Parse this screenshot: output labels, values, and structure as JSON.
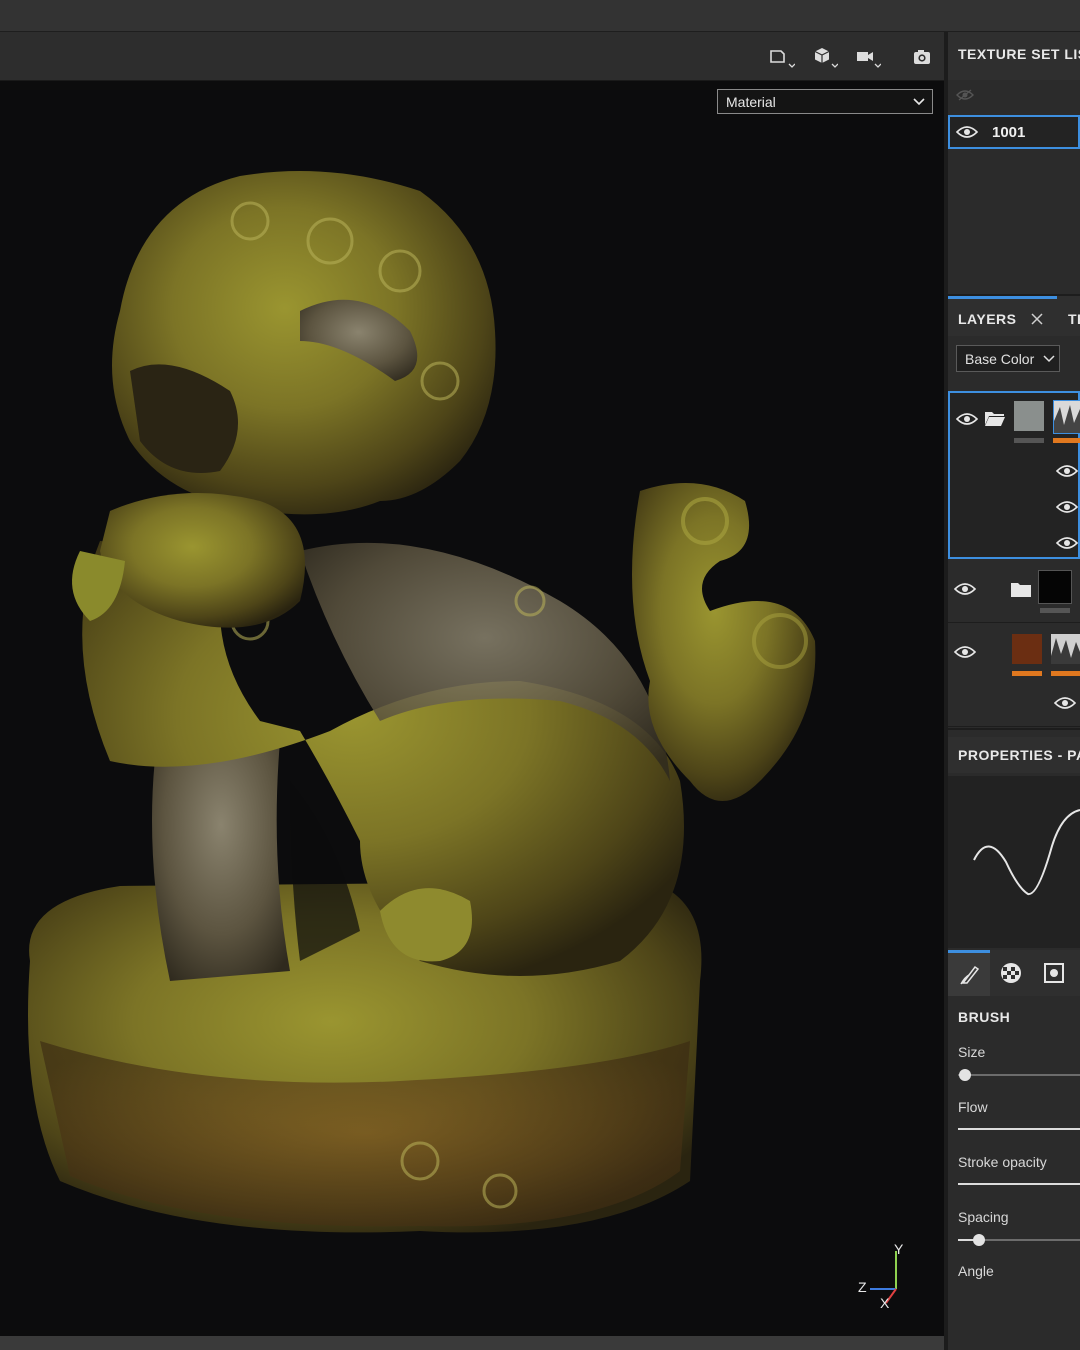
{
  "viewport": {
    "toolbar_icons": [
      "frame-select-icon",
      "cube-view-icon",
      "camera-icon",
      "screenshot-icon"
    ],
    "material_select": {
      "value": "Material"
    },
    "axis_gizmo": {
      "x": "X",
      "y": "Y",
      "z": "Z"
    }
  },
  "texture_set_list": {
    "title": "TEXTURE SET LIS",
    "items": [
      {
        "name": "1001"
      }
    ]
  },
  "layers": {
    "tab_label": "LAYERS",
    "next_tab_label": "TE",
    "channel_select": "Base Color"
  },
  "properties": {
    "title": "PROPERTIES - PA"
  },
  "brush": {
    "title": "BRUSH",
    "params": [
      {
        "label": "Size",
        "value": 0.0
      },
      {
        "label": "Flow",
        "value": 1.0
      },
      {
        "label": "Stroke opacity",
        "value": 1.0
      },
      {
        "label": "Spacing",
        "value": 0.15
      },
      {
        "label": "Angle"
      }
    ]
  },
  "colors": {
    "accent": "#3d8fe0",
    "orange": "#e0781f",
    "panel": "#2b2b2b",
    "viewport": "#0c0c0d"
  }
}
